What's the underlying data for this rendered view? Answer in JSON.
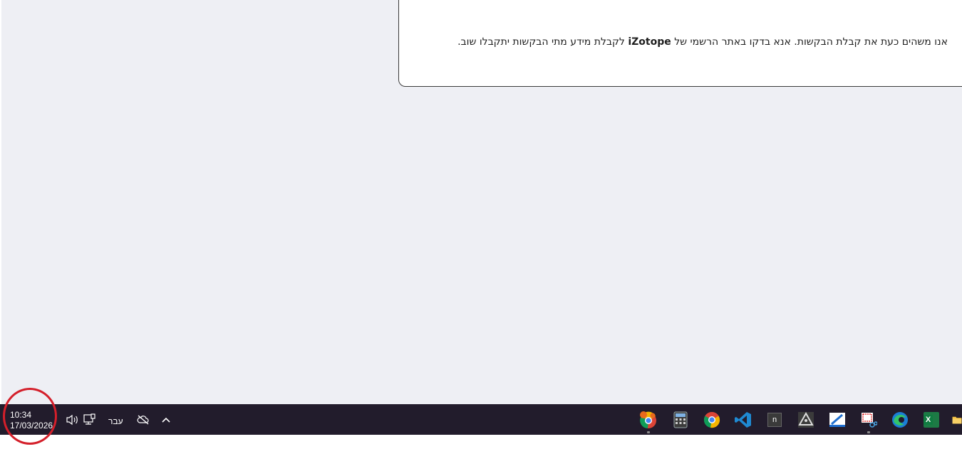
{
  "notice": {
    "text_part1": "אנו משהים כעת את קבלת הבקשות. אנא בדקו באתר הרשמי של ",
    "brand": "iZotope",
    "text_part2": " לקבלת מידע מתי הבקשות יתקבלו שוב."
  },
  "taskbar": {
    "clock": {
      "time": "10:34",
      "date": "17/03/2026"
    },
    "language": "עבר",
    "tray_icons": [
      "speaker-icon",
      "network-icon",
      "cloud-off-icon",
      "chevron-up-icon"
    ],
    "apps": [
      {
        "name": "chrome-profile",
        "badge": ""
      },
      {
        "name": "calculator"
      },
      {
        "name": "chrome"
      },
      {
        "name": "vscode"
      },
      {
        "name": "notepad-n",
        "label": "n"
      },
      {
        "name": "inkscape"
      },
      {
        "name": "paint-bucket"
      },
      {
        "name": "snipping-tool"
      },
      {
        "name": "edge"
      },
      {
        "name": "excel",
        "label": "X"
      },
      {
        "name": "file-explorer"
      }
    ],
    "highlight_color": "#d41f2a"
  }
}
